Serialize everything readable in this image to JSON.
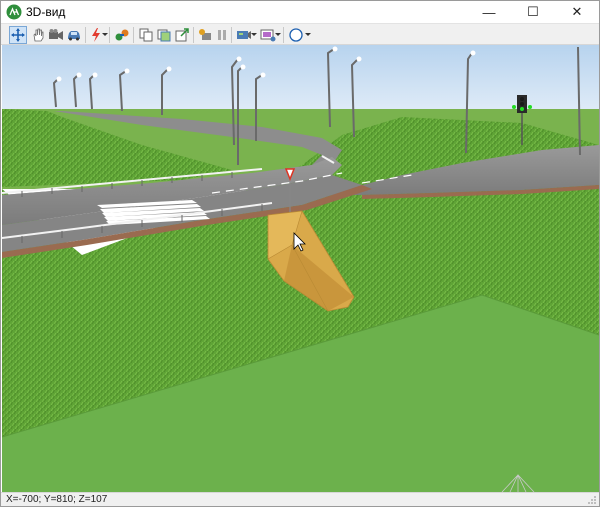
{
  "window": {
    "title": "3D-вид",
    "minimize": "—",
    "maximize": "☐",
    "close": "✕"
  },
  "toolbar": {
    "buttons": [
      {
        "name": "move-tool",
        "icon": "move-arrows-icon",
        "active": true
      },
      {
        "name": "pan-tool",
        "icon": "hand-icon"
      },
      {
        "name": "camera-tool",
        "icon": "video-camera-icon"
      },
      {
        "name": "vehicle-tool",
        "icon": "car-icon"
      },
      {
        "name": "lightning-tool",
        "icon": "lightning-icon",
        "dropdown": true
      },
      {
        "name": "link-tool",
        "icon": "link-icon"
      },
      {
        "name": "copy-tool",
        "icon": "copy-icon"
      },
      {
        "name": "layers-tool",
        "icon": "layers-icon"
      },
      {
        "name": "export-tool",
        "icon": "export-icon"
      },
      {
        "name": "record-tool",
        "icon": "record-icon"
      },
      {
        "name": "pause-tool",
        "icon": "pause-icon"
      },
      {
        "name": "view-tool",
        "icon": "view-icon",
        "dropdown": true
      },
      {
        "name": "screen-tool",
        "icon": "screen-icon",
        "dropdown": true
      },
      {
        "name": "compass-tool",
        "icon": "compass-icon",
        "dropdown": true
      }
    ]
  },
  "colors": {
    "sky_top": "#b9d4ee",
    "sky_bottom": "#eef4fb",
    "grass": "#63a83a",
    "flat_green": "#6ab04c",
    "road": "#8a8a8a",
    "curb": "#9a6b50",
    "mound": "#d8a848"
  },
  "status": {
    "coords": "X=-700; Y=810; Z=107"
  }
}
